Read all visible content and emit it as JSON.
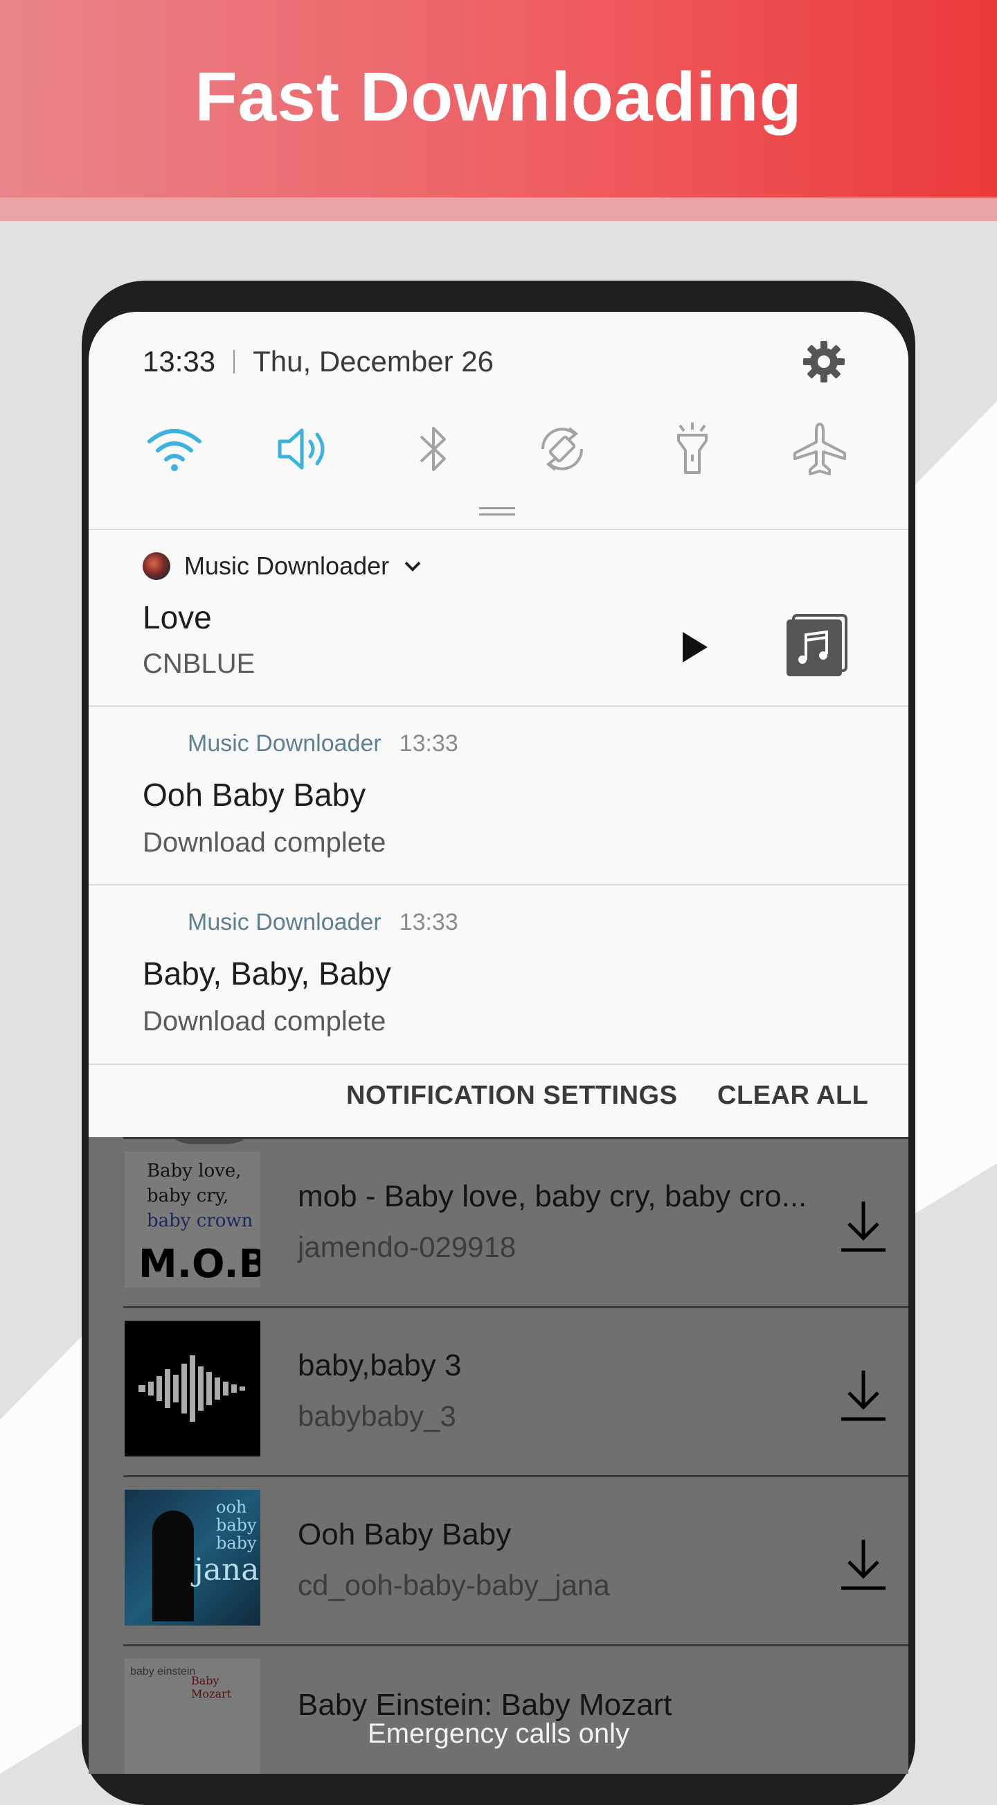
{
  "banner": {
    "title": "Fast Downloading"
  },
  "status_bar": {
    "time": "13:33",
    "date": "Thu, December 26"
  },
  "quick_settings": [
    "wifi-icon",
    "sound-icon",
    "bluetooth-icon",
    "auto-rotate-icon",
    "flashlight-icon",
    "airplane-mode-icon"
  ],
  "colors": {
    "accent": "#3bb3de",
    "banner_start": "#e9858a",
    "banner_end": "#ec3a3b",
    "app_name": "#5e7f92"
  },
  "media_notification": {
    "app_name": "Music Downloader",
    "title": "Love",
    "artist": "CNBLUE"
  },
  "notifications": [
    {
      "app_name": "Music Downloader",
      "time": "13:33",
      "title": "Ooh Baby Baby",
      "text": "Download complete"
    },
    {
      "app_name": "Music Downloader",
      "time": "13:33",
      "title": "Baby, Baby, Baby",
      "text": "Download complete"
    }
  ],
  "actions": {
    "settings": "NOTIFICATION SETTINGS",
    "clear_all": "CLEAR ALL"
  },
  "songs": [
    {
      "title": "mob - Baby love, baby cry, baby cro...",
      "subtitle": "jamendo-029918",
      "thumb_lines": [
        "Baby love,",
        "baby cry,",
        "baby crown"
      ],
      "thumb_logo": "M.O.B"
    },
    {
      "title": "baby,baby 3",
      "subtitle": "babybaby_3"
    },
    {
      "title": "Ooh Baby Baby",
      "subtitle": "cd_ooh-baby-baby_jana",
      "thumb_lines": [
        "ooh",
        "baby",
        "baby"
      ],
      "thumb_logo": "jana"
    },
    {
      "title": "Baby Einstein: Baby Mozart",
      "subtitle": "",
      "thumb_lines": [
        "baby einstein",
        "Baby Mozart"
      ]
    }
  ],
  "lock_screen": {
    "emergency": "Emergency calls only"
  }
}
